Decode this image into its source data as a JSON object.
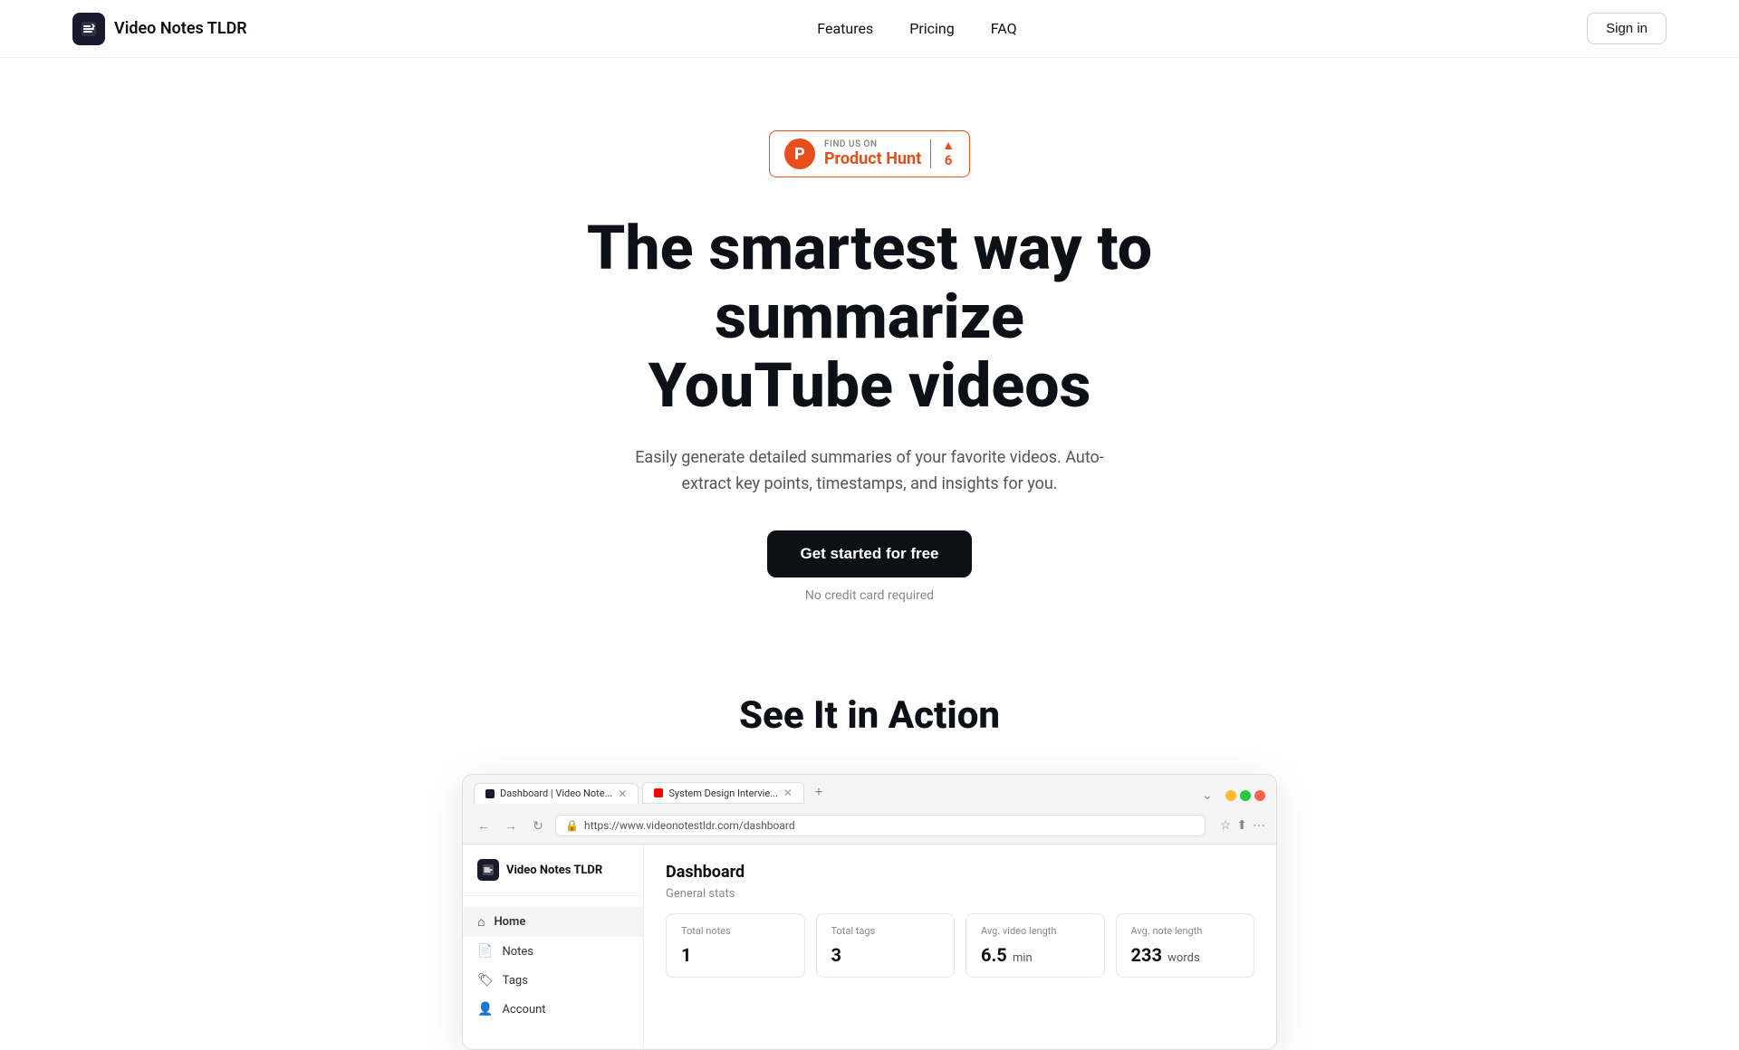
{
  "header": {
    "logo_text": "Video Notes TLDR",
    "nav": {
      "features": "Features",
      "pricing": "Pricing",
      "faq": "FAQ"
    },
    "sign_in": "Sign in"
  },
  "hero": {
    "product_hunt": {
      "find_us_on": "FIND US ON",
      "name": "Product Hunt",
      "vote_count": "6"
    },
    "title_line1": "The smartest way to summarize",
    "title_line2": "YouTube videos",
    "subtitle": "Easily generate detailed summaries of your favorite videos. Auto-extract key points, timestamps, and insights for you.",
    "cta_label": "Get started for free",
    "no_credit_card": "No credit card required"
  },
  "action_section": {
    "title": "See It in Action"
  },
  "browser": {
    "tabs": [
      {
        "label": "Dashboard | Video Note...",
        "type": "vn",
        "active": true
      },
      {
        "label": "System Design Intervie...",
        "type": "yt",
        "active": false
      }
    ],
    "url": "https://www.videonotestldr.com/dashboard",
    "window_controls": [
      "close",
      "min",
      "max"
    ]
  },
  "dashboard": {
    "sidebar": {
      "logo_text": "Video Notes TLDR",
      "nav_items": [
        {
          "label": "Home",
          "icon": "home-icon"
        },
        {
          "label": "Notes",
          "icon": "notes-icon"
        },
        {
          "label": "Tags",
          "icon": "tags-icon"
        },
        {
          "label": "Account",
          "icon": "account-icon"
        }
      ]
    },
    "title": "Dashboard",
    "general_stats_label": "General stats",
    "stats": [
      {
        "label": "Total notes",
        "value": "1",
        "unit": ""
      },
      {
        "label": "Total tags",
        "value": "3",
        "unit": ""
      },
      {
        "label": "Avg. video length",
        "value": "6.5",
        "unit": "min"
      },
      {
        "label": "Avg. note length",
        "value": "233",
        "unit": "words"
      }
    ]
  }
}
